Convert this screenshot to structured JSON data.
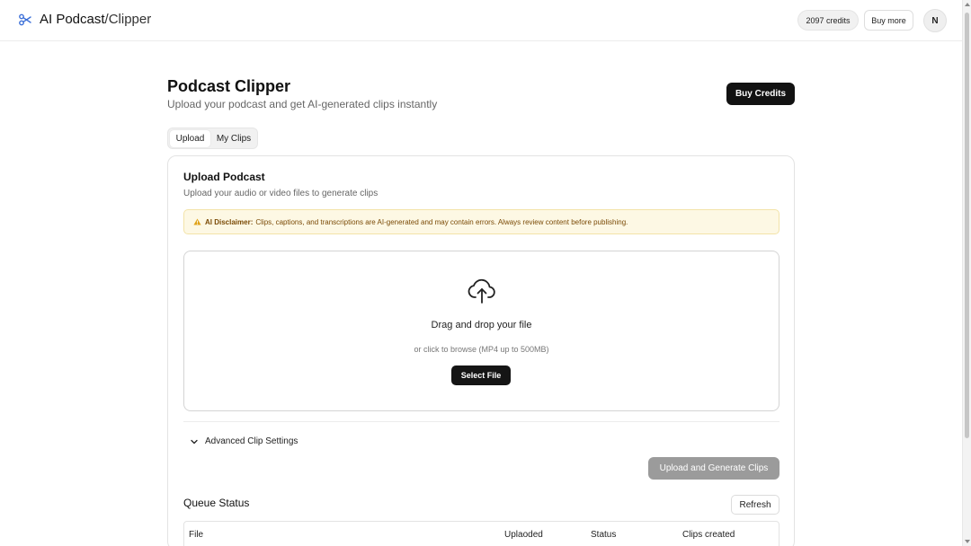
{
  "header": {
    "brand_main": "AI Podcast",
    "brand_sep": "/",
    "brand_sub": "Clipper",
    "credits": "2097 credits",
    "buy_more": "Buy more",
    "avatar_initial": "N"
  },
  "page": {
    "title": "Podcast Clipper",
    "subtitle": "Upload your podcast and get AI-generated clips instantly",
    "buy_credits": "Buy Credits"
  },
  "tabs": [
    {
      "label": "Upload",
      "active": true
    },
    {
      "label": "My Clips",
      "active": false
    }
  ],
  "upload_card": {
    "title": "Upload Podcast",
    "description": "Upload your audio or video files to generate clips",
    "disclaimer_label": "AI Disclaimer:",
    "disclaimer_text": "Clips, captions, and transcriptions are AI-generated and may contain errors. Always review content before publishing.",
    "dropzone_title": "Drag and drop your file",
    "dropzone_sub": "or click to browse (MP4 up to 500MB)",
    "select_file": "Select File",
    "advanced_settings": "Advanced Clip Settings",
    "upload_generate": "Upload and Generate Clips"
  },
  "queue": {
    "title": "Queue Status",
    "refresh": "Refresh",
    "columns": [
      "File",
      "Uplaoded",
      "Status",
      "Clips created"
    ]
  },
  "colors": {
    "primary": "#121212",
    "disabled": "#9b9b9b",
    "warning_bg": "#fdf8e4",
    "warning_text": "#7a4a06",
    "brand_icon": "#3b6fd8"
  },
  "icons": {
    "brand": "scissors-icon",
    "warning": "warning-icon",
    "upload": "cloud-upload-icon",
    "chevron": "chevron-down-icon"
  }
}
